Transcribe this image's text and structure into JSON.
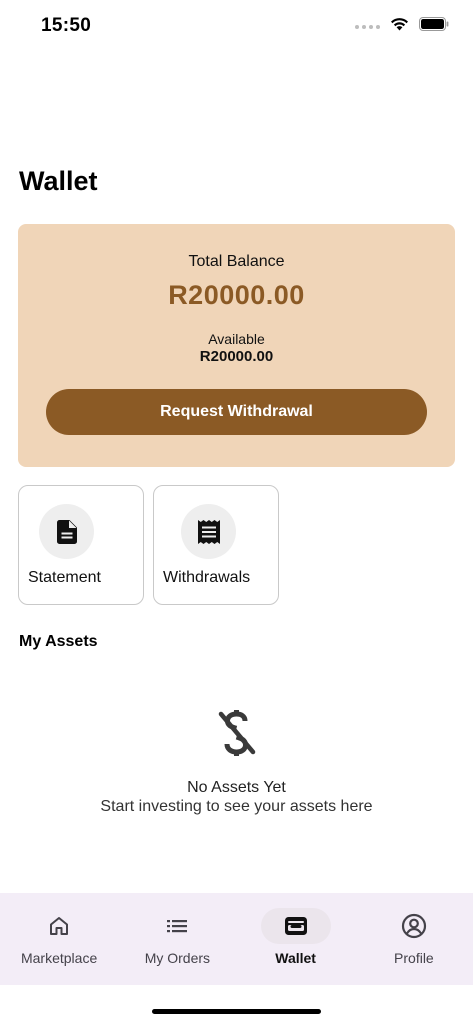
{
  "status_bar": {
    "time": "15:50",
    "icons": [
      "signal-dots-icon",
      "wifi-icon",
      "battery-icon"
    ]
  },
  "page": {
    "title": "Wallet"
  },
  "balance_card": {
    "label": "Total Balance",
    "amount": "R20000.00",
    "available_label": "Available",
    "available_amount": "R20000.00",
    "withdraw_button_label": "Request Withdrawal"
  },
  "actions": [
    {
      "label": "Statement",
      "icon": "document-icon"
    },
    {
      "label": "Withdrawals",
      "icon": "receipt-icon"
    }
  ],
  "assets": {
    "title": "My Assets",
    "empty_icon": "no-money-icon",
    "empty_title": "No Assets Yet",
    "empty_subtitle": "Start investing to see your assets here"
  },
  "bottom_nav": {
    "items": [
      {
        "label": "Marketplace",
        "icon": "home-icon",
        "active": false
      },
      {
        "label": "My Orders",
        "icon": "list-icon",
        "active": false
      },
      {
        "label": "Wallet",
        "icon": "wallet-icon",
        "active": true
      },
      {
        "label": "Profile",
        "icon": "profile-icon",
        "active": false
      }
    ]
  },
  "colors": {
    "accent": "#8b5a25",
    "card_background": "#f0d5b8",
    "nav_background": "#f3edf7"
  }
}
